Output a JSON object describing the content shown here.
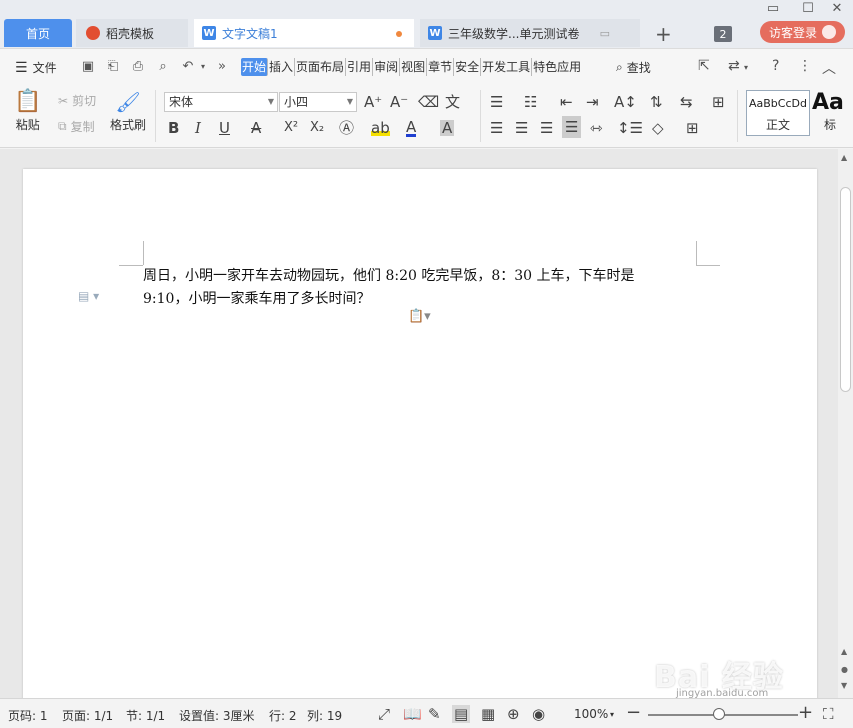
{
  "window": {
    "controls": [
      "▭",
      "☐",
      "✕"
    ]
  },
  "tabs": {
    "home": "首页",
    "templates": "稻壳模板",
    "doc": "文字文稿1",
    "exam": "三年级数学...单元测试卷",
    "new_tab": "+",
    "count": "2",
    "login": "访客登录"
  },
  "menu": {
    "file": "文件",
    "items": [
      "开始",
      "插入",
      "页面布局",
      "引用",
      "审阅",
      "视图",
      "章节",
      "安全",
      "开发工具",
      "特色应用"
    ],
    "search": "查找",
    "help": "?"
  },
  "ribbon": {
    "paste": "粘贴",
    "cut": "剪切",
    "copy": "复制",
    "format_painter": "格式刷",
    "font_name": "宋体",
    "font_size": "小四",
    "style_sample": "AaBbCcDd",
    "style_name": "正文",
    "style2_sample": "Aa",
    "style2_name": "标",
    "bold": "B",
    "italic": "I",
    "underline": "U",
    "superscript": "X²",
    "subscript": "X₂"
  },
  "document": {
    "line1": "周日，小明一家开车去动物园玩，他们 8:20 吃完早饭，8：30 上车，下车时是",
    "line2": "9:10，小明一家乘车用了多长时间？"
  },
  "status": {
    "page_num": "页码: 1",
    "pages": "页面: 1/1",
    "section": "节: 1/1",
    "setting": "设置值: 3厘米",
    "row": "行: 2",
    "col": "列: 19",
    "zoom": "100%",
    "zoom_level": 1.0
  },
  "watermark": {
    "text": "Bai 经验",
    "sub": "jingyan.baidu.com"
  }
}
